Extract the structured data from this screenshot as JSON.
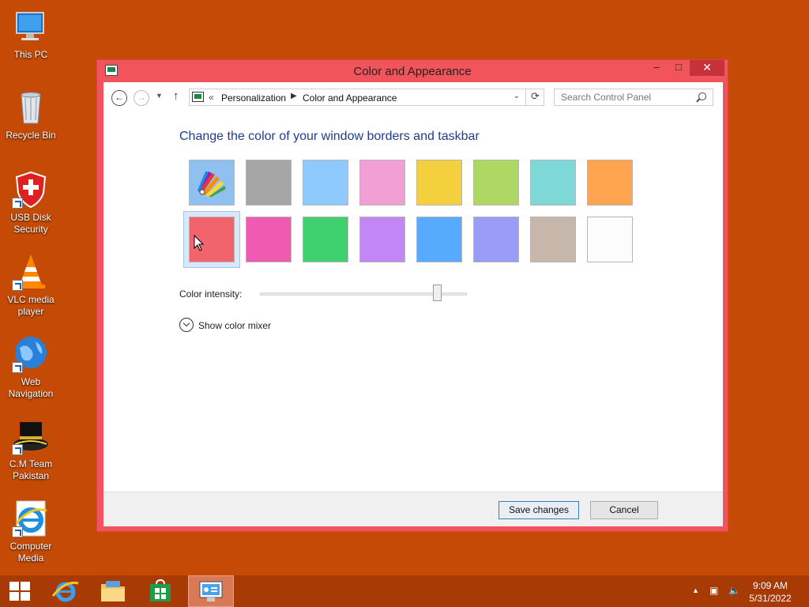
{
  "desktop": {
    "icons": [
      {
        "label": "This PC"
      },
      {
        "label": "Recycle Bin"
      },
      {
        "label": "USB Disk Security"
      },
      {
        "label": "VLC media player"
      },
      {
        "label": "Web Navigation"
      },
      {
        "label": "C.M Team Pakistan"
      },
      {
        "label": "Computer Media"
      }
    ],
    "background_color": "#c44a06"
  },
  "window": {
    "title": "Color and Appearance",
    "controls": {
      "minimize": "–",
      "maximize": "□",
      "close": "✕"
    },
    "accent_color": "#f2545b"
  },
  "navbar": {
    "breadcrumb_prefix": "«",
    "breadcrumbs": [
      "Personalization",
      "Color and Appearance"
    ],
    "search_placeholder": "Search Control Panel"
  },
  "main": {
    "heading": "Change the color of your window borders and taskbar",
    "swatches_row1": [
      "automatic",
      "#a6a6a6",
      "#8fcaff",
      "#f29fd6",
      "#f4d03f",
      "#aed863",
      "#7ed8d8",
      "#ffa54f"
    ],
    "swatches_row2": [
      "#f2646c",
      "#f05bb1",
      "#3ecf6e",
      "#c387f5",
      "#57aaff",
      "#9b9bf8",
      "#c7b7aa",
      "#fcfcfc"
    ],
    "selected_swatch": "#f2646c",
    "intensity_label": "Color intensity:",
    "intensity_value": 0.85,
    "mixer_label": "Show color mixer"
  },
  "footer": {
    "save_label": "Save changes",
    "cancel_label": "Cancel"
  },
  "taskbar": {
    "time": "9:09 AM",
    "date": "5/31/2022"
  }
}
